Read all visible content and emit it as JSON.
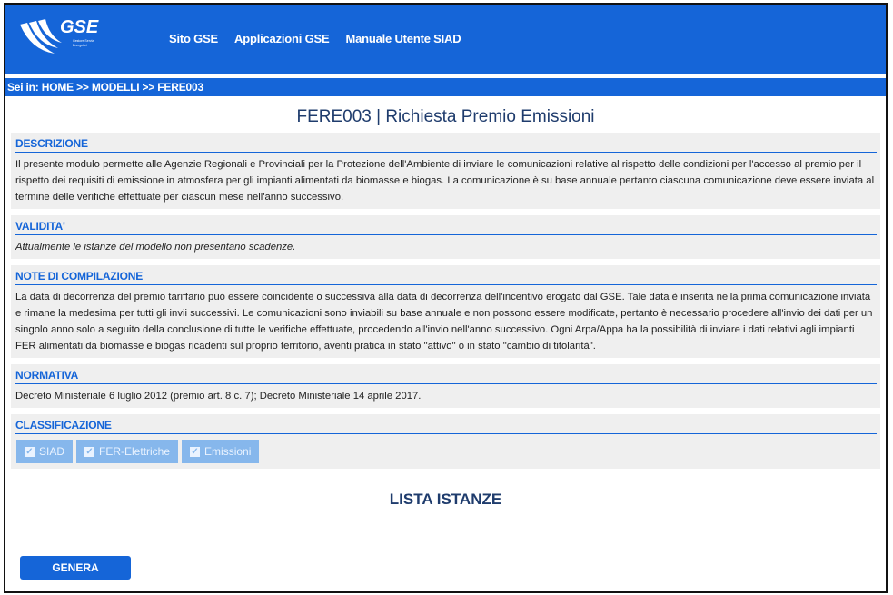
{
  "header": {
    "logo_text": "GSE",
    "logo_subtext": "Gestore Servizi Energetici",
    "nav": [
      "Sito GSE",
      "Applicazioni GSE",
      "Manuale Utente SIAD"
    ]
  },
  "breadcrumb": "Sei in: HOME >> MODELLI >> FERE003",
  "page_title": "FERE003 | Richiesta Premio Emissioni",
  "sections": {
    "descrizione": {
      "title": "DESCRIZIONE",
      "text": "Il presente modulo permette alle Agenzie Regionali e Provinciali per la Protezione dell'Ambiente di inviare le comunicazioni relative al rispetto delle condizioni per l'accesso al premio per il rispetto dei requisiti di emissione in atmosfera per gli impianti alimentati da biomasse e biogas. La comunicazione è su base annuale pertanto ciascuna comunicazione deve essere inviata al termine delle verifiche effettuate per ciascun mese nell'anno successivo."
    },
    "validita": {
      "title": "VALIDITA'",
      "text": "Attualmente le istanze del modello non presentano scadenze."
    },
    "note": {
      "title": "NOTE DI COMPILAZIONE",
      "text": "La data di decorrenza del premio tariffario può essere coincidente o successiva alla data di decorrenza dell'incentivo erogato dal GSE. Tale data è inserita nella prima comunicazione inviata e rimane la medesima per tutti gli invii successivi. Le comunicazioni sono inviabili su base annuale e non possono essere modificate, pertanto è necessario procedere all'invio dei dati per un singolo anno solo a seguito della conclusione di tutte le verifiche effettuate, procedendo all'invio nell'anno successivo. Ogni Arpa/Appa ha la possibilità di inviare i dati relativi agli impianti FER alimentati da biomasse e biogas ricadenti sul proprio territorio, aventi pratica in stato \"attivo\" o in stato \"cambio di titolarità\"."
    },
    "normativa": {
      "title": "NORMATIVA",
      "text": "Decreto Ministeriale 6 luglio 2012 (premio art. 8 c. 7); Decreto Ministeriale 14 aprile 2017."
    },
    "classificazione": {
      "title": "CLASSIFICAZIONE",
      "tags": [
        "SIAD",
        "FER-Elettriche",
        "Emissioni"
      ]
    }
  },
  "list_title": "LISTA ISTANZE",
  "genera_label": "GENERA",
  "colors": {
    "brand_blue": "#1565d8",
    "tag_blue": "#86b7ec",
    "section_bg": "#efefef"
  }
}
